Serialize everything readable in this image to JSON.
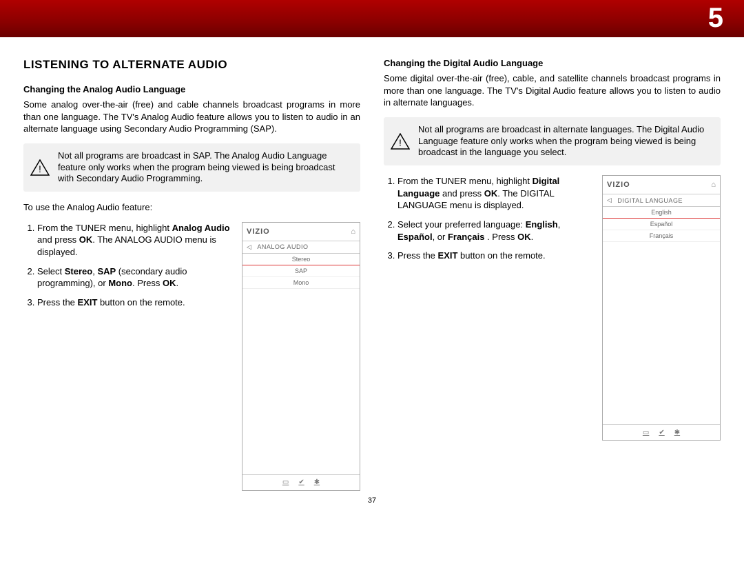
{
  "chapter_number": "5",
  "page_number": "37",
  "section_title": "LISTENING TO ALTERNATE AUDIO",
  "analog": {
    "heading": "Changing the Analog Audio Language",
    "intro": "Some analog over-the-air (free) and cable channels broadcast programs in more than one language. The TV's Analog Audio feature allows you to listen to audio in an alternate language using Secondary Audio Programming (SAP).",
    "note": "Not all programs are broadcast in SAP. The Analog Audio Language feature only works when the program being viewed is being broadcast with Secondary Audio Programming.",
    "lead_in": "To use the Analog Audio feature:",
    "steps_html": [
      "From the TUNER menu, highlight <b>Analog Audio</b> and press <b>OK</b>. The ANALOG AUDIO menu is displayed.",
      "Select <b>Stereo</b>, <b>SAP</b> (secondary audio programming), or <b>Mono</b>. Press <b>OK</b>.",
      "Press the <b>EXIT</b> button on the remote."
    ],
    "menu": {
      "brand": "VIZIO",
      "title": "ANALOG AUDIO",
      "options": [
        "Stereo",
        "SAP",
        "Mono"
      ]
    }
  },
  "digital": {
    "heading": "Changing the Digital Audio Language",
    "intro": "Some digital over-the-air (free), cable, and satellite channels broadcast programs in more than one language. The TV's Digital Audio feature allows you to listen to audio in alternate languages.",
    "note": "Not all programs are broadcast in alternate languages. The Digital Audio Language feature only works when the program being viewed is being broadcast in the language you select.",
    "steps_html": [
      "From the TUNER menu, highlight <b>Digital Language</b> and press <b>OK</b>. The DIGITAL LANGUAGE menu is displayed.",
      "Select your preferred language: <b>English</b>, <b>Español</b>,  or <b>Français</b> . Press <b>OK</b>.",
      "Press the <b>EXIT</b> button on the remote."
    ],
    "menu": {
      "brand": "VIZIO",
      "title": "DIGITAL LANGUAGE",
      "options": [
        "English",
        "Español",
        "Français"
      ]
    }
  }
}
